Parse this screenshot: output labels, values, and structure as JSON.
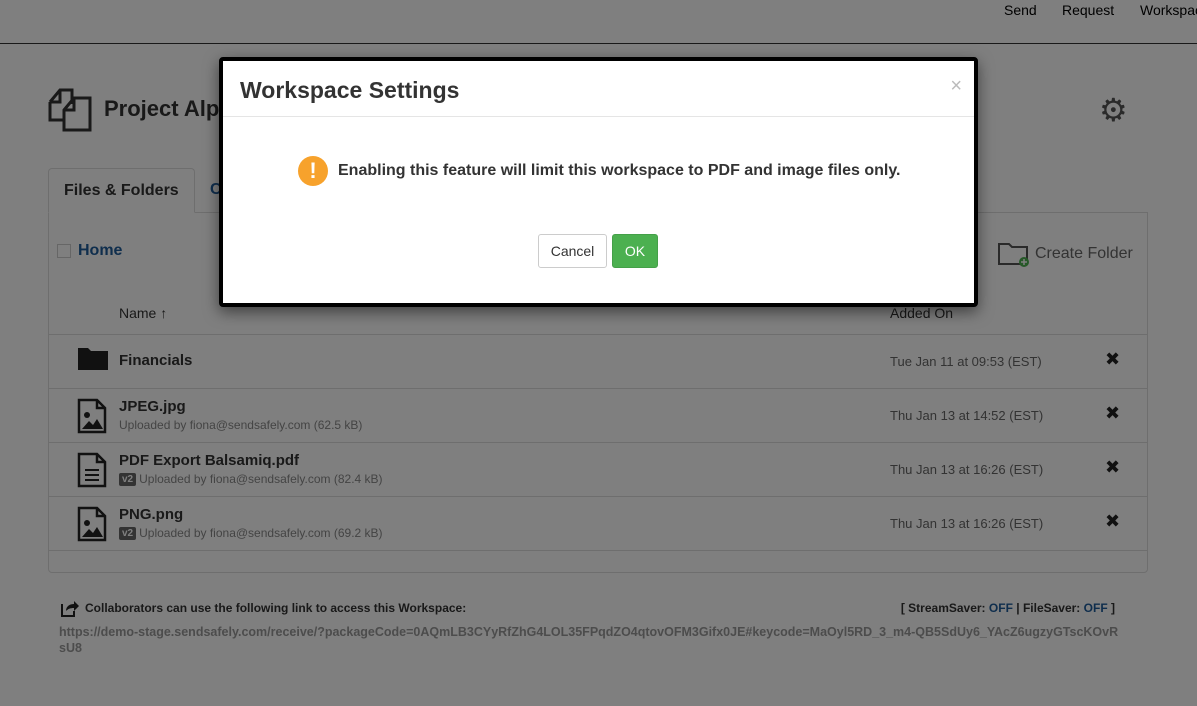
{
  "topnav": {
    "items": [
      "Send",
      "Request",
      "Workspace"
    ]
  },
  "workspace": {
    "title": "Project Alpha"
  },
  "tabs": [
    "Files & Folders",
    "C"
  ],
  "breadcrumb": {
    "home": "Home"
  },
  "create_folder": "Create Folder",
  "table": {
    "headers": {
      "name": "Name ↑",
      "added": "Added On"
    },
    "rows": [
      {
        "type": "folder",
        "name": "Financials",
        "sub": "",
        "version": "",
        "date": "Tue Jan 11 at 09:53 (EST)"
      },
      {
        "type": "image",
        "name": "JPEG.jpg",
        "sub": "Uploaded by fiona@sendsafely.com (62.5 kB)",
        "version": "",
        "date": "Thu Jan 13 at 14:52 (EST)"
      },
      {
        "type": "document",
        "name": "PDF Export Balsamiq.pdf",
        "sub": "Uploaded by fiona@sendsafely.com (82.4 kB)",
        "version": "v2",
        "date": "Thu Jan 13 at 16:26 (EST)"
      },
      {
        "type": "image",
        "name": "PNG.png",
        "sub": "Uploaded by fiona@sendsafely.com (69.2 kB)",
        "version": "v2",
        "date": "Thu Jan 13 at 16:26 (EST)"
      }
    ]
  },
  "footer": {
    "label": "Collaborators can use the following link to access this Workspace:",
    "streamsaver_label": "[ StreamSaver:",
    "streamsaver": "OFF",
    "filesaver_label": "| FileSaver:",
    "filesaver": "OFF",
    "end": "]",
    "url": "https://demo-stage.sendsafely.com/receive/?packageCode=0AQmLB3CYyRfZhG4LOL35FPqdZO4qtovOFM3Gifx0JE#keycode=MaOyl5RD_3_m4-QB5SdUy6_YAcZ6ugzyGTscKOvRsU8"
  },
  "modal": {
    "title": "Workspace Settings",
    "close": "×",
    "message": "Enabling this feature will limit this workspace to PDF and image files only.",
    "cancel": "Cancel",
    "ok": "OK"
  },
  "colors": {
    "ok": "#4cb050",
    "warning": "#f7a22c",
    "link": "#1f5c9b"
  }
}
